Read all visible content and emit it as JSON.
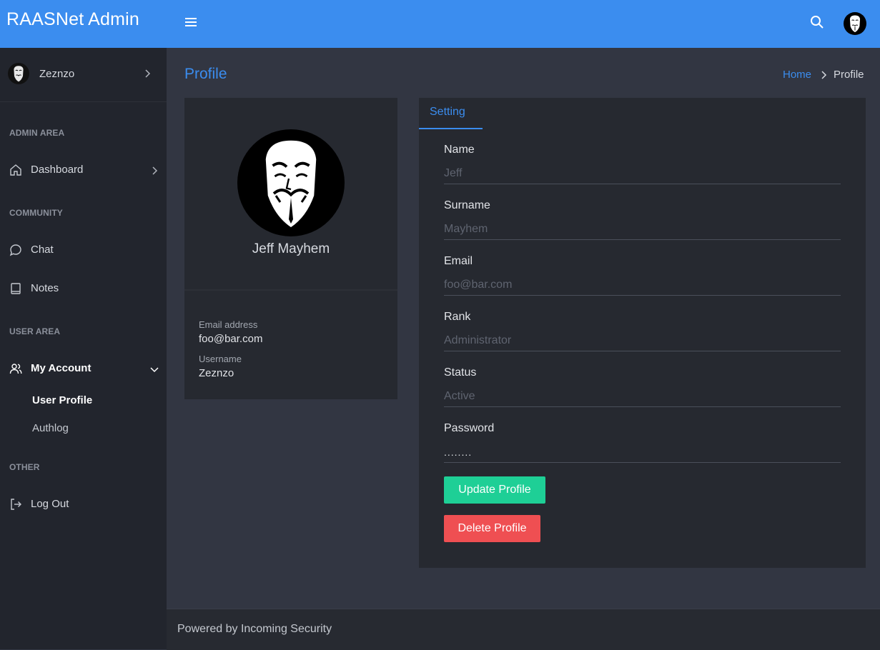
{
  "app": {
    "title": "RAASNet Admin"
  },
  "topbar": {
    "menu_icon": "hamburger-icon",
    "search_icon": "search-icon",
    "avatar_icon": "anonymous-mask-avatar"
  },
  "sidebar": {
    "user": {
      "name": "Zeznzo"
    },
    "sections": {
      "admin": "ADMIN AREA",
      "community": "COMMUNITY",
      "user": "USER AREA",
      "other": "OTHER"
    },
    "items": {
      "dashboard": "Dashboard",
      "chat": "Chat",
      "notes": "Notes",
      "my_account": "My Account",
      "user_profile": "User Profile",
      "authlog": "Authlog",
      "logout": "Log Out"
    }
  },
  "page": {
    "title": "Profile",
    "breadcrumb": {
      "home": "Home",
      "current": "Profile"
    }
  },
  "profile": {
    "full_name": "Jeff Mayhem",
    "email_label": "Email address",
    "email": "foo@bar.com",
    "username_label": "Username",
    "username": "Zeznzo"
  },
  "settings": {
    "tab": "Setting",
    "fields": {
      "name": {
        "label": "Name",
        "placeholder": "Jeff"
      },
      "surname": {
        "label": "Surname",
        "placeholder": "Mayhem"
      },
      "email": {
        "label": "Email",
        "placeholder": "foo@bar.com"
      },
      "rank": {
        "label": "Rank",
        "placeholder": "Administrator"
      },
      "status": {
        "label": "Status",
        "placeholder": "Active"
      },
      "password": {
        "label": "Password",
        "value": "........"
      }
    },
    "update_button": "Update Profile",
    "delete_button": "Delete Profile"
  },
  "footer": {
    "text": "Powered by Incoming Security"
  },
  "colors": {
    "accent": "#3b8def",
    "update": "#1ecf96",
    "delete": "#ef4f52",
    "sidebar": "#22252d",
    "content": "#323642",
    "card": "#262930"
  }
}
